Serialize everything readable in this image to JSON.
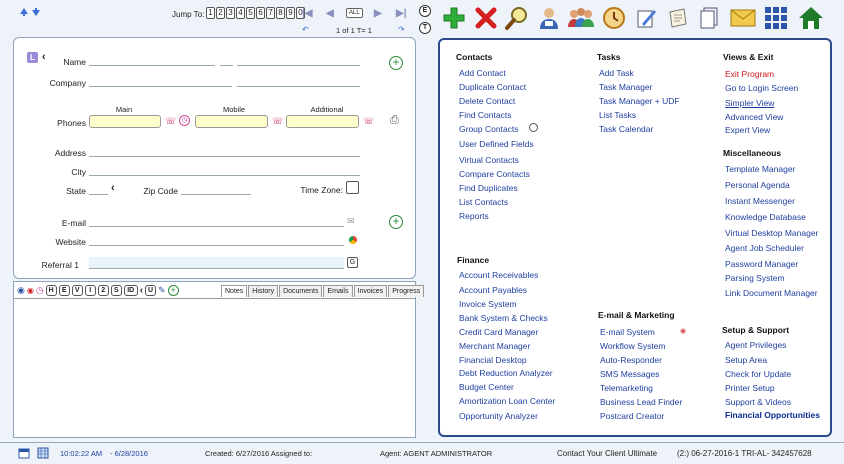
{
  "nav": {
    "jump_label": "Jump To:",
    "jump_pages": [
      "1",
      "2",
      "3",
      "4",
      "5",
      "6",
      "7",
      "8",
      "9",
      "0"
    ],
    "all_label": "ALL",
    "pager_text": "1 of 1 T= 1",
    "round_e": "E",
    "round_t": "T"
  },
  "form": {
    "l_badge": "L",
    "name_label": "Name",
    "company_label": "Company",
    "phones_label": "Phones",
    "main_label": "Main",
    "mobile_label": "Mobile",
    "additional_label": "Additional",
    "address_label": "Address",
    "city_label": "City",
    "state_label": "State",
    "zip_label": "Zip Code",
    "timezone_label": "Time Zone:",
    "email_label": "E-mail",
    "website_label": "Website",
    "referral_label": "Referral 1",
    "g_label": "G"
  },
  "notes": {
    "toolbar_letters": [
      "H",
      "E",
      "V",
      "I",
      "2",
      "S",
      "ID"
    ],
    "u_label": "U",
    "tabs": [
      "Notes",
      "History",
      "Documents",
      "Emails",
      "Invoices",
      "Progress"
    ]
  },
  "menu": {
    "contacts": {
      "title": "Contacts",
      "items": [
        "Add Contact",
        "Duplicate Contact",
        "Delete Contact",
        "Find Contacts",
        "Group Contacts",
        "User Defined Fields",
        "Virtual Contacts",
        "Compare Contacts",
        "Find Duplicates",
        "List Contacts",
        "Reports"
      ]
    },
    "tasks": {
      "title": "Tasks",
      "items": [
        "Add Task",
        "Task Manager",
        "Task Manager + UDF",
        "List Tasks",
        "Task Calendar"
      ]
    },
    "views": {
      "title": "Views & Exit",
      "items": [
        "Exit Program",
        "Go to Login Screen",
        "Simpler View",
        "Advanced View",
        "Expert View"
      ]
    },
    "misc": {
      "title": "Miscellaneous",
      "items": [
        "Template Manager",
        "Personal Agenda",
        "Instant Messenger",
        "Knowledge Database",
        "Virtual Desktop Manager",
        "Agent Job Scheduler",
        "Password Manager",
        "Parsing System",
        "Link Document Manager"
      ]
    },
    "finance": {
      "title": "Finance",
      "items": [
        "Account Receivables",
        "Account Payables",
        "Invoice System",
        "Bank System & Checks",
        "Credit Card Manager",
        "Merchant Manager",
        "Financial Desktop",
        "Debt Reduction Analyzer",
        "Budget Center",
        "Amortization Loan Center",
        "Opportunity Analyzer"
      ]
    },
    "email": {
      "title": "E-mail & Marketing",
      "items": [
        "E-mail System",
        "Workflow System",
        "Auto-Responder",
        "SMS Messages",
        "Telemarketing",
        "Business Lead Finder",
        "Postcard Creator"
      ]
    },
    "setup": {
      "title": "Setup & Support",
      "items": [
        "Agent Privileges",
        "Setup Area",
        "Check for Update",
        "Printer Setup",
        "Support & Videos",
        "Financial Opportunities"
      ]
    }
  },
  "status": {
    "time": "10:02:22 AM",
    "date": "- 6/28/2016",
    "created": "Created: 6/27/2016 Assigned to:",
    "agent": "Agent: AGENT  ADMINISTRATOR",
    "product": "Contact Your Client Ultimate",
    "version": "(2:) 06-27-2016-1 TRI-AL- 342457628"
  },
  "colors": {
    "menu_link": "#1f3fa0",
    "exit_red": "#d01818",
    "panel_border": "#2c4a8a"
  }
}
